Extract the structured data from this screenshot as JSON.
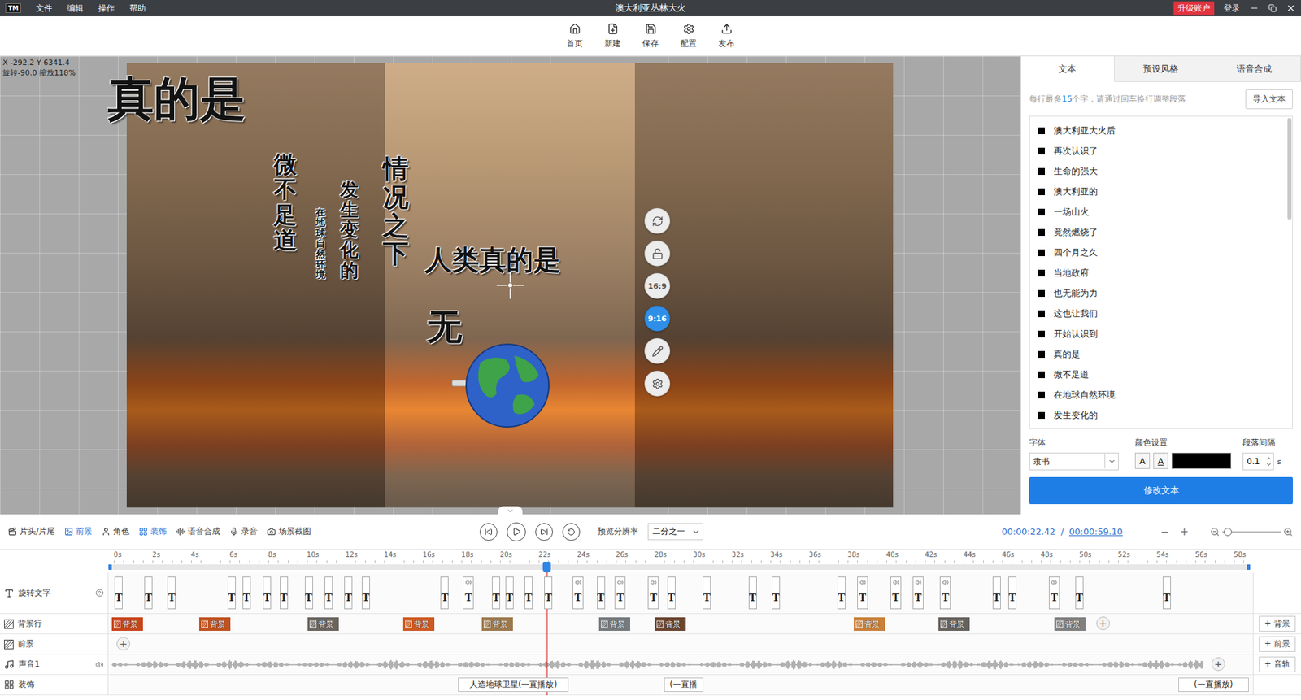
{
  "window": {
    "title": "澳大利亚丛林大火",
    "logo": "TM",
    "menu": [
      "文件",
      "编辑",
      "操作",
      "帮助"
    ],
    "upgrade": "升级账户",
    "login": "登录"
  },
  "toolbar": [
    "首页",
    "新建",
    "保存",
    "配置",
    "发布"
  ],
  "canvas": {
    "coords": "X -292.2 Y 6341.4",
    "transform": "旋转-90.0 缩放118%",
    "texts": [
      {
        "text": "真的是",
        "kind": "horizontal"
      },
      {
        "text": "微不足道",
        "kind": "vertical"
      },
      {
        "text": "在地球自然环境",
        "kind": "vertical"
      },
      {
        "text": "发生变化的",
        "kind": "vertical"
      },
      {
        "text": "情况之下",
        "kind": "vertical"
      },
      {
        "text": "人类真的是",
        "kind": "horizontal"
      },
      {
        "text": "无",
        "kind": "horizontal"
      }
    ],
    "tools": [
      {
        "kind": "rotate",
        "label": "",
        "selected": false
      },
      {
        "kind": "lock",
        "label": "",
        "selected": false
      },
      {
        "kind": "ratio",
        "label": "16:9",
        "selected": false
      },
      {
        "kind": "ratio",
        "label": "9:16",
        "selected": true
      },
      {
        "kind": "edit",
        "label": "",
        "selected": false
      },
      {
        "kind": "settings",
        "label": "",
        "selected": false
      }
    ]
  },
  "panel": {
    "tabs": [
      {
        "label": "文本",
        "selected": true
      },
      {
        "label": "预设风格",
        "selected": false
      },
      {
        "label": "语音合成",
        "selected": false
      }
    ],
    "hint_before": "每行最多",
    "hint_count": "15",
    "hint_after": "个字，请通过回车换行调整段落",
    "import": "导入文本",
    "lines": [
      "澳大利亚大火后",
      "再次认识了",
      "生命的强大",
      "澳大利亚的",
      "一场山火",
      "竟然燃烧了",
      "四个月之久",
      "当地政府",
      "也无能为力",
      "这也让我们",
      "开始认识到",
      "真的是",
      "微不足道",
      "在地球自然环境",
      "发生变化的"
    ],
    "font_label": "字体",
    "font": "隶书",
    "color_label": "颜色设置",
    "color_buttons": [
      "A",
      "A"
    ],
    "text_color": "#000000",
    "spacing_label": "段落间隔",
    "spacing": "0.1",
    "spacing_unit": "s",
    "submit": "修改文本"
  },
  "timeline": {
    "tools": [
      {
        "label": "片头/片尾",
        "kind": "intro",
        "selected": false
      },
      {
        "label": "前景",
        "kind": "foreground",
        "selected": true
      },
      {
        "label": "角色",
        "kind": "role",
        "selected": false
      },
      {
        "label": "装饰",
        "kind": "decoration",
        "selected": true
      },
      {
        "label": "语音合成",
        "kind": "tts",
        "selected": false
      },
      {
        "label": "录音",
        "kind": "record",
        "selected": false
      },
      {
        "label": "场景截图",
        "kind": "screenshot",
        "selected": false
      }
    ],
    "resolution_label": "预览分辨率",
    "resolution": "二分之一",
    "current_time": "00:00:22.42",
    "separator": "/",
    "total_time": "00:00:59.10",
    "minus": "−",
    "plus": "+",
    "zoom_level": 0.05,
    "playhead_level": 0.3794,
    "ruler": [
      "0s",
      "2s",
      "4s",
      "6s",
      "8s",
      "10s",
      "12s",
      "14s",
      "16s",
      "18s",
      "20s",
      "22s",
      "24s",
      "26s",
      "28s",
      "30s",
      "32s",
      "34s",
      "36s",
      "38s",
      "40s",
      "42s",
      "44s",
      "46s",
      "48s",
      "50s",
      "52s",
      "54s",
      "56s",
      "58s"
    ],
    "tracks": [
      {
        "label": "旋转文字",
        "kind": "text",
        "add": ""
      },
      {
        "label": "背景行",
        "kind": "background",
        "add": "+ 背景"
      },
      {
        "label": "前景",
        "kind": "foreground",
        "add": "+ 前景"
      },
      {
        "label": "声音1",
        "kind": "audio",
        "add": "+ 音轨"
      },
      {
        "label": "装饰",
        "kind": "decoration",
        "add": ""
      }
    ],
    "text_clip_glyph": "T",
    "add_clip": "+",
    "text_clips": [
      {
        "voice": false
      },
      {
        "voice": false
      },
      {
        "voice": false
      },
      {
        "voice": false
      },
      {
        "voice": false
      },
      {
        "voice": false
      },
      {
        "voice": false
      },
      {
        "voice": false
      },
      {
        "voice": false
      },
      {
        "voice": false
      },
      {
        "voice": false
      },
      {
        "voice": false
      },
      {
        "voice": true
      },
      {
        "voice": false
      },
      {
        "voice": false
      },
      {
        "voice": false
      },
      {
        "voice": false
      },
      {
        "voice": true
      },
      {
        "voice": false
      },
      {
        "voice": true
      },
      {
        "voice": true
      },
      {
        "voice": false
      },
      {
        "voice": false
      },
      {
        "voice": false
      },
      {
        "voice": false
      },
      {
        "voice": false
      },
      {
        "voice": true
      },
      {
        "voice": true
      },
      {
        "voice": true
      },
      {
        "voice": true
      },
      {
        "voice": false
      },
      {
        "voice": false
      },
      {
        "voice": true
      },
      {
        "voice": false
      },
      {
        "voice": false
      }
    ],
    "background_clips": [
      {
        "label": "背景",
        "color": "#c8461c"
      },
      {
        "label": "背景",
        "color": "#c0521f"
      },
      {
        "label": "背景",
        "color": "#6b6560"
      },
      {
        "label": "背景",
        "color": "#cc5a22"
      },
      {
        "label": "背景",
        "color": "#9c7a4e"
      },
      {
        "label": "背景",
        "color": "#767a7c"
      },
      {
        "label": "背景",
        "color": "#6a4530"
      },
      {
        "label": "背景",
        "color": "#c9803a"
      },
      {
        "label": "背景",
        "color": "#66625e"
      },
      {
        "label": "背景",
        "color": "#808080"
      }
    ],
    "decoration_clips": [
      "人造地球卫星(一直播放)",
      "(一直播",
      "(一直播放)"
    ]
  }
}
